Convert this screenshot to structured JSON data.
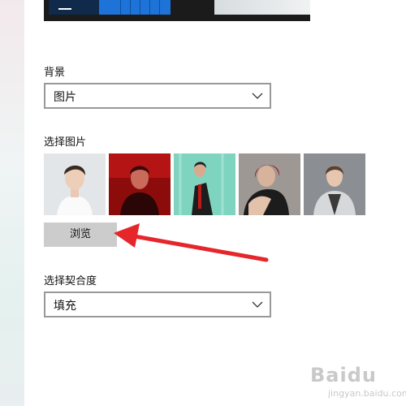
{
  "background_section": {
    "label": "背景",
    "select_value": "图片"
  },
  "choose_picture_section": {
    "label": "选择图片",
    "thumbnails": [
      "photo-1",
      "photo-2",
      "photo-3",
      "photo-4",
      "photo-5"
    ],
    "browse_label": "浏览"
  },
  "fit_section": {
    "label": "选择契合度",
    "select_value": "填充"
  },
  "watermark": {
    "brand": "Baidu",
    "sub": "jingyan.baidu.com"
  },
  "colors": {
    "accent_blue": "#1e73d8",
    "arrow_red": "#e5262b",
    "button_gray": "#cccccc"
  }
}
